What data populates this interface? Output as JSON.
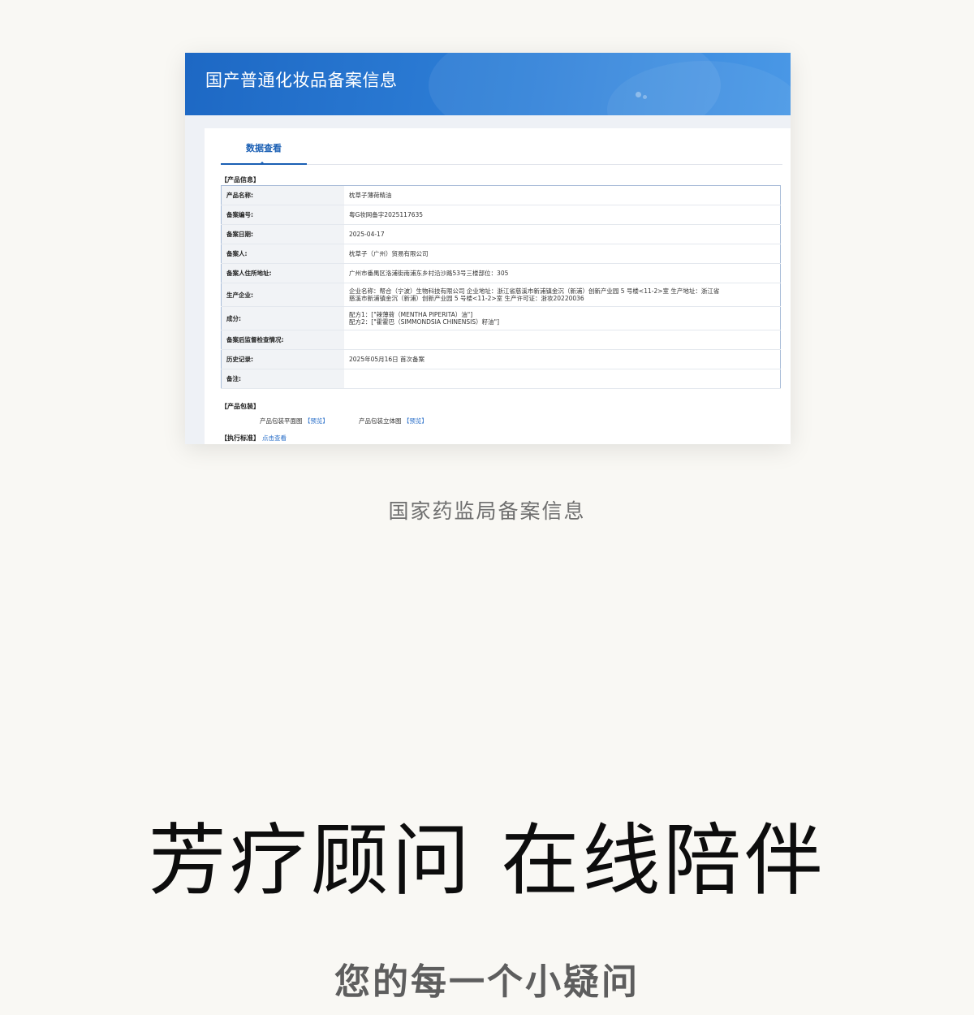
{
  "screenshot": {
    "header_title": "国产普通化妆品备案信息",
    "tab_label": "数据查看",
    "product_info_label": "【产品信息】",
    "rows": [
      {
        "key": "产品名称:",
        "value": "枕草子薄荷精油"
      },
      {
        "key": "备案编号:",
        "value": "粤G妆网备字2025117635"
      },
      {
        "key": "备案日期:",
        "value": "2025-04-17"
      },
      {
        "key": "备案人:",
        "value": "枕草子（广州）贸易有限公司"
      },
      {
        "key": "备案人住所地址:",
        "value": "广州市番禺区洛浦街南浦东乡村沿沙路53号三楼部位：305"
      },
      {
        "key": "生产企业:",
        "value": "企业名称：帮合（宁波）生物科技有限公司 企业地址：浙江省慈溪市新浦镇金沉（新浦）创新产业园 5 号楼<11-2>室 生产地址：浙江省\n慈溪市新浦镇金沉（新浦）创新产业园 5 号楼<11-2>室 生产许可证：浙妆20220036"
      },
      {
        "key": "成分:",
        "value": "配方1：[\"辣薄荷（MENTHA PIPERITA）油\"]\n配方2：[\"霍霍巴（SIMMONDSIA CHINENSIS）籽油\"]"
      },
      {
        "key": "备案后监督检查情况:",
        "value": ""
      },
      {
        "key": "历史记录:",
        "value": "2025年05月16日 首次备案"
      },
      {
        "key": "备注:",
        "value": ""
      }
    ],
    "packaging_label": "【产品包装】",
    "packaging_items": [
      {
        "label": "产品包装平面图",
        "open_bracket": "【",
        "link": "预览",
        "close_bracket": "】"
      },
      {
        "label": "产品包装立体图",
        "open_bracket": "【",
        "link": "预览",
        "close_bracket": "】"
      }
    ],
    "standard_label": "【执行标准】",
    "standard_link": "点击查看"
  },
  "caption": "国家药监局备案信息",
  "headline": "芳疗顾问 在线陪伴",
  "subline": "您的每一个小疑问",
  "colors": {
    "header_blue": "#1d68c4",
    "link_blue": "#2a6fc9",
    "background": "#f9f8f4"
  }
}
